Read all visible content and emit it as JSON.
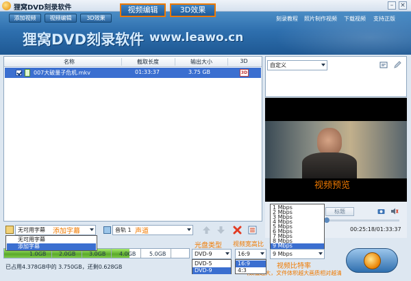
{
  "window": {
    "title": "狸窝DVD刻录软件",
    "minimize": "–",
    "close": "×"
  },
  "nav": {
    "tabs": [
      "添加视频",
      "视频编辑",
      "3D效果"
    ],
    "callouts": [
      "视频编辑",
      "3D效果"
    ],
    "links": [
      "刻录教程",
      "照片制作视频",
      "下载视频",
      "支持正版"
    ]
  },
  "banner": {
    "title": "狸窝DVD刻录软件",
    "url": "www.leawo.cn"
  },
  "table": {
    "headers": [
      "名称",
      "截取长度",
      "输出大小",
      "3D"
    ],
    "rows": [
      {
        "name": "007大破量子危机.mkv",
        "length": "01:33:37",
        "size": "3.75 GB",
        "three_d": "3D"
      }
    ]
  },
  "toolbar": {
    "subtitle_value": "无可用字幕",
    "subtitle_annotation": "添加字幕",
    "subtitle_options": [
      "无可用字幕",
      "添加字幕"
    ],
    "audio_value": "音轨 1",
    "audio_annotation": "声道"
  },
  "capacity": {
    "used_fraction": 0.678,
    "ticks": [
      "1.0GB",
      "2.0GB",
      "3.0GB",
      "4.0GB",
      "5.0GB"
    ],
    "status": "已占用4.378GB中的 3.750GB，还剩0.628GB"
  },
  "disc": {
    "label": "光盘类型",
    "value": "DVD-9",
    "options": [
      "DVD-5",
      "DVD-9"
    ]
  },
  "aspect": {
    "label": "视频宽高比",
    "value": "16:9",
    "options": [
      "16:9",
      "4:3"
    ]
  },
  "bitrate": {
    "label": "视频比特率",
    "note": "(数值越大，文件体积越大画质相对越清晰)",
    "value": "9 Mbps",
    "options": [
      "1 Mbps",
      "2 Mbps",
      "3 Mbps",
      "4 Mbps",
      "5 Mbps",
      "6 Mbps",
      "7 Mbps",
      "8 Mbps",
      "9 Mbps"
    ]
  },
  "preview": {
    "mode": "自定义",
    "label": "视频预览",
    "mark_button": "标题",
    "time": "00:25:18/01:33:37"
  },
  "colors": {
    "accent": "#f07a00",
    "header": "#2e6fae",
    "selection": "#3b6fd0"
  }
}
